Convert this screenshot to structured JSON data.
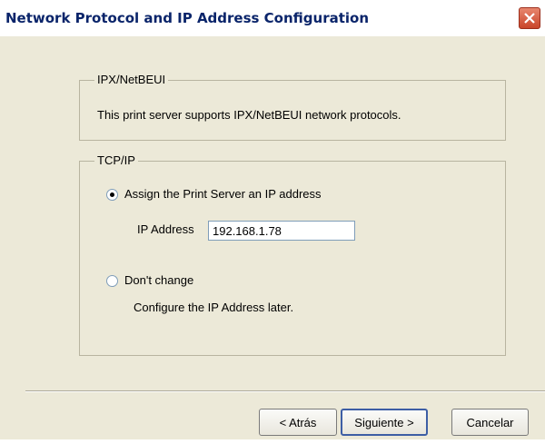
{
  "window": {
    "title": "Network Protocol and IP Address Configuration"
  },
  "ipx_group": {
    "label": "IPX/NetBEUI",
    "description": "This print server supports IPX/NetBEUI network protocols."
  },
  "tcpip_group": {
    "label": "TCP/IP",
    "options": [
      {
        "label": "Assign the Print Server an IP address",
        "selected": true
      },
      {
        "label": "Don't change",
        "selected": false
      }
    ],
    "ip_address_label": "IP Address",
    "ip_address_value": "192.168.1.78",
    "later_note": "Configure the IP Address later."
  },
  "buttons": {
    "back": "< Atrás",
    "next": "Siguiente >",
    "cancel": "Cancelar"
  },
  "colors": {
    "title_text": "#0a246a",
    "dialog_bg": "#ece9d8",
    "close_button": "#c9452a"
  }
}
